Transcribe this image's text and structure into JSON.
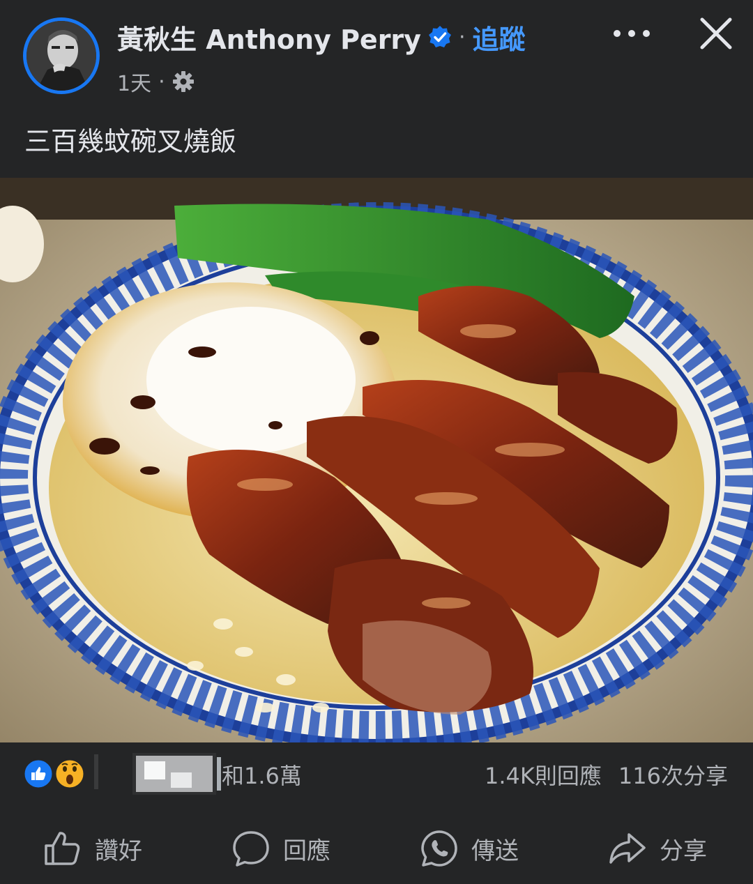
{
  "post": {
    "author_name": "黃秋生 Anthony Perry",
    "follow_label": "追蹤",
    "dot_separator": "·",
    "time": "1天",
    "caption": "三百幾蚊碗叉燒飯"
  },
  "header_icons": {
    "verified": "verified-badge-icon",
    "privacy": "gear-icon",
    "more": "more-options-icon",
    "close": "close-icon"
  },
  "stats": {
    "reaction_text": "和1.6萬",
    "comments": "1.4K則回應",
    "shares": "116次分享",
    "reaction_icons": [
      "like-reaction-icon",
      "wow-reaction-icon"
    ]
  },
  "actions": [
    {
      "label": "讚好",
      "icon": "thumbs-up-icon"
    },
    {
      "label": "回應",
      "icon": "comment-bubble-icon"
    },
    {
      "label": "傳送",
      "icon": "whatsapp-icon"
    },
    {
      "label": "分享",
      "icon": "share-arrow-icon"
    }
  ],
  "colors": {
    "background": "#242526",
    "primary_text": "#e4e6eb",
    "secondary_text": "#b0b3b8",
    "accent_blue": "#4599ff",
    "verified_blue": "#1877f2"
  }
}
